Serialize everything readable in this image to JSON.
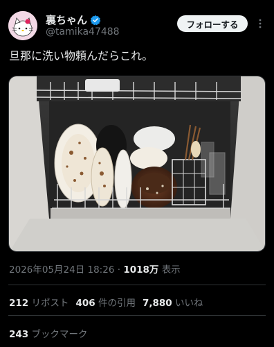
{
  "user": {
    "display_name": "裏ちゃん",
    "handle": "@tamika47488",
    "verified": true,
    "accent_color": "#1d9bf0"
  },
  "actions": {
    "follow_label": "フォローする",
    "more_icon": "more-vertical-icon"
  },
  "tweet": {
    "text": "旦那に洗い物頼んだらこれ。",
    "image": "dishwasher photo with dirty plates and bowls"
  },
  "meta": {
    "timestamp": "2026年05月24日 18:26",
    "separator": "·",
    "views_count": "1018万",
    "views_label": "表示"
  },
  "stats": {
    "reposts_count": "212",
    "reposts_label": "リポスト",
    "quotes_count": "406",
    "quotes_label": "件の引用",
    "likes_count": "7,880",
    "likes_label": "いいね",
    "bookmarks_count": "243",
    "bookmarks_label": "ブックマーク"
  }
}
